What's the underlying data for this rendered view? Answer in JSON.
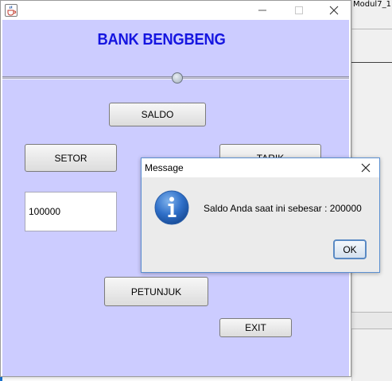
{
  "background": {
    "ide_tab_label": "Modul7_1"
  },
  "window": {
    "title": "",
    "app_title": "BANK BENGBENG",
    "buttons": {
      "saldo": "SALDO",
      "setor": "SETOR",
      "tarik": "TARIK",
      "petunjuk": "PETUNJUK",
      "exit": "EXIT"
    },
    "amount_field": {
      "value": "100000"
    }
  },
  "dialog": {
    "title": "Message",
    "message": "Saldo Anda saat ini sebesar : 200000",
    "ok_label": "OK",
    "icon": "info-icon"
  },
  "colors": {
    "content_bg": "#ccccff",
    "title_blue": "#1515e0"
  }
}
